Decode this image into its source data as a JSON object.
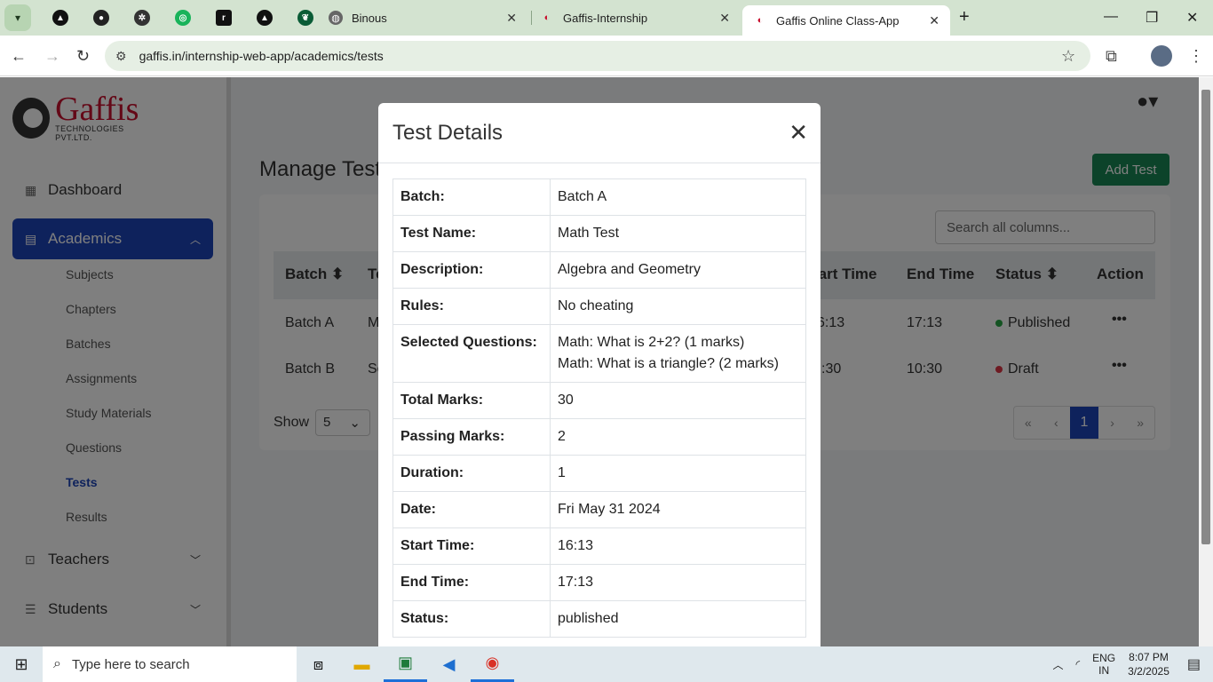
{
  "browser": {
    "tabs": [
      {
        "title": "Binous"
      },
      {
        "title": "Gaffis-Internship"
      },
      {
        "title": "Gaffis Online Class-App"
      }
    ],
    "url": "gaffis.in/internship-web-app/academics/tests"
  },
  "sidebar": {
    "logo_text": "Gaffis",
    "logo_sub": "TECHNOLOGIES PVT.LTD.",
    "dashboard": "Dashboard",
    "academics": "Academics",
    "sub_items": [
      "Subjects",
      "Chapters",
      "Batches",
      "Assignments",
      "Study Materials",
      "Questions",
      "Tests",
      "Results"
    ],
    "teachers": "Teachers",
    "students": "Students"
  },
  "main": {
    "title": "Manage Test",
    "add_button": "Add Test",
    "search_placeholder": "Search all columns...",
    "columns": [
      "Batch",
      "Te",
      "tart Time",
      "End Time",
      "Status",
      "Action"
    ],
    "rows": [
      {
        "batch": "Batch A",
        "test": "M",
        "start": "6:13",
        "end": "17:13",
        "status": "Published",
        "status_color": "#28a745"
      },
      {
        "batch": "Batch B",
        "test": "Sc",
        "start": ":30",
        "end": "10:30",
        "status": "Draft",
        "status_color": "#dc3545"
      }
    ],
    "show_label": "Show",
    "show_value": "5",
    "pager": [
      "«",
      "‹",
      "1",
      "›",
      "»"
    ]
  },
  "modal": {
    "title": "Test Details",
    "rows": [
      {
        "key": "Batch:",
        "value": "Batch A"
      },
      {
        "key": "Test Name:",
        "value": "Math Test"
      },
      {
        "key": "Description:",
        "value": "Algebra and Geometry"
      },
      {
        "key": "Rules:",
        "value": "No cheating"
      },
      {
        "key": "Selected Questions:",
        "value": "Math: What is 2+2? (1 marks)",
        "value2": "Math: What is a triangle? (2 marks)"
      },
      {
        "key": "Total Marks:",
        "value": "30"
      },
      {
        "key": "Passing Marks:",
        "value": "2"
      },
      {
        "key": "Duration:",
        "value": "1"
      },
      {
        "key": "Date:",
        "value": "Fri May 31 2024"
      },
      {
        "key": "Start Time:",
        "value": "16:13"
      },
      {
        "key": "End Time:",
        "value": "17:13"
      },
      {
        "key": "Status:",
        "value": "published"
      }
    ]
  },
  "taskbar": {
    "search_placeholder": "Type here to search",
    "lang": "ENG",
    "region": "IN",
    "time": "8:07 PM",
    "date": "3/2/2025"
  }
}
